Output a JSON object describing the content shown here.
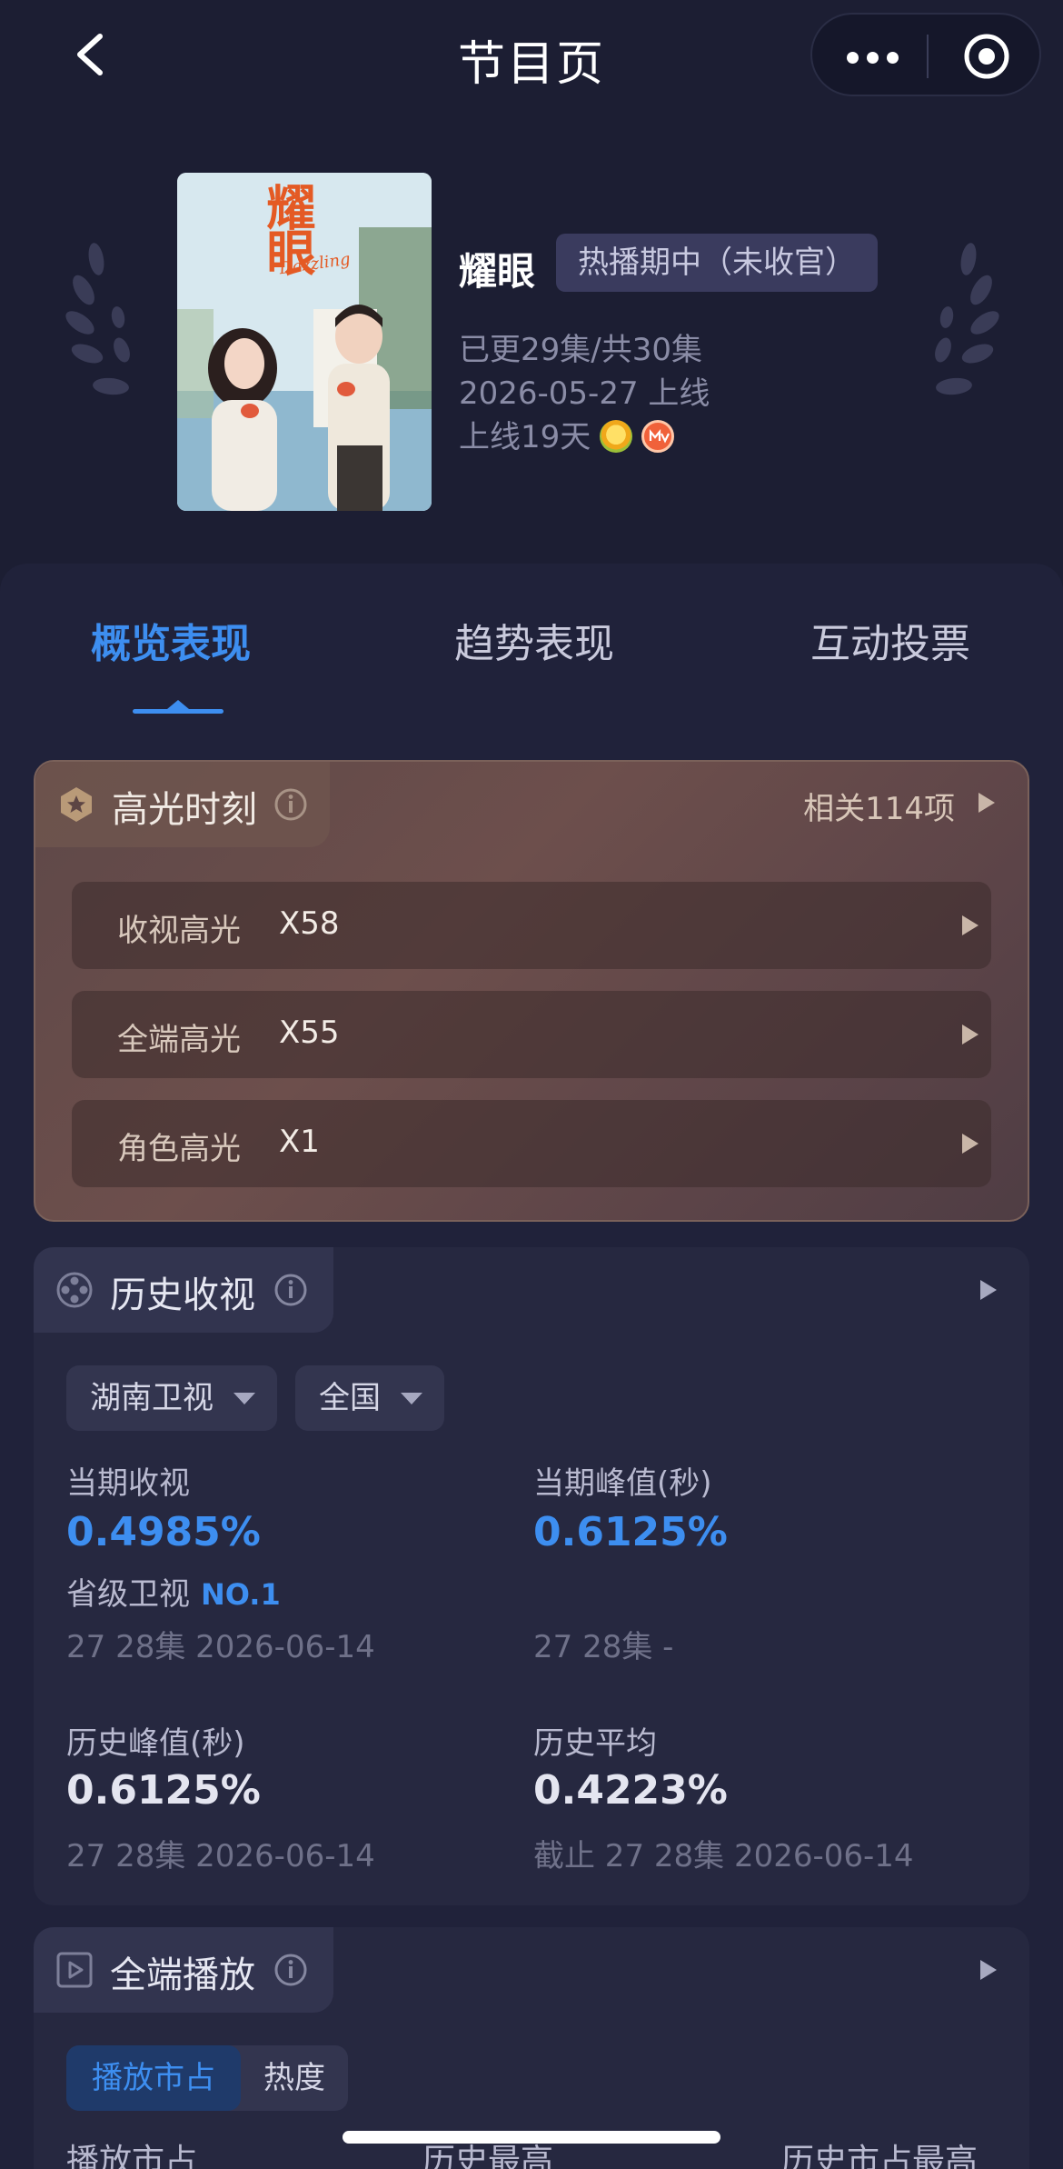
{
  "nav": {
    "title": "节目页"
  },
  "show": {
    "name": "耀眼",
    "status": "热播期中（未收官）",
    "episodes": "已更29集/共30集",
    "premiere": "2026-05-27 上线",
    "days_online": "上线19天",
    "poster_title": "耀眼",
    "poster_subtitle": "Dazzling"
  },
  "tabs": [
    {
      "label": "概览表现",
      "active": true
    },
    {
      "label": "趋势表现",
      "active": false
    },
    {
      "label": "互动投票",
      "active": false
    }
  ],
  "highlights": {
    "title": "高光时刻",
    "related": "相关114项",
    "rows": [
      {
        "label": "收视高光",
        "value": "X58"
      },
      {
        "label": "全端高光",
        "value": "X55"
      },
      {
        "label": "角色高光",
        "value": "X1"
      }
    ]
  },
  "history_ratings": {
    "title": "历史收视",
    "channel": "湖南卫视",
    "region": "全国",
    "current_rating": {
      "label": "当期收视",
      "value": "0.4985%",
      "rank_label": "省级卫视",
      "rank": "NO.1",
      "sub": "27 28集 2026-06-14"
    },
    "current_peak": {
      "label": "当期峰值(秒)",
      "value": "0.6125%",
      "sub": "27 28集 -"
    },
    "history_peak": {
      "label": "历史峰值(秒)",
      "value": "0.6125%",
      "sub": "27 28集 2026-06-14"
    },
    "history_avg": {
      "label": "历史平均",
      "value": "0.4223%",
      "sub": "截止 27 28集 2026-06-14"
    }
  },
  "playback": {
    "title": "全端播放",
    "segments": [
      {
        "label": "播放市占",
        "active": true
      },
      {
        "label": "热度",
        "active": false
      }
    ],
    "bottom_labels": [
      "播放市占",
      "历史最高",
      "历史市占最高"
    ]
  },
  "colors": {
    "background": "#1c1e33",
    "accent": "#3d8ef0",
    "highlight_card": "#6d4f4c"
  }
}
